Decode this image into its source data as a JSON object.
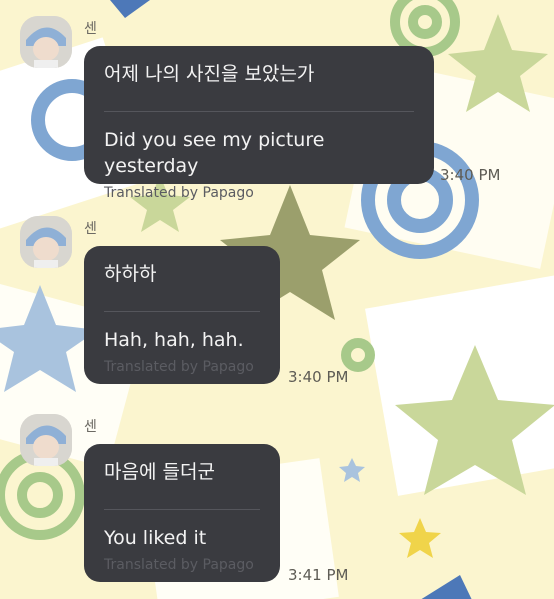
{
  "messages": [
    {
      "sender": "센",
      "original": "어제 나의 사진을 보았는가",
      "translation": "Did you see my picture yesterday",
      "credit": "Translated by Papago",
      "time": "3:40 PM"
    },
    {
      "sender": "센",
      "original": "하하하",
      "translation": "Hah, hah, hah.",
      "credit": "Translated by Papago",
      "time": "3:40 PM"
    },
    {
      "sender": "센",
      "original": "마음에 들더군",
      "translation": "You liked it",
      "credit": "Translated by Papago",
      "time": "3:41 PM"
    }
  ],
  "theme": {
    "background": "#fbf5cf",
    "bubble": "#3a3b40",
    "star_green": "#c9d79a",
    "star_blue": "#a9c3de",
    "spiral_blue": "#7fa6d2",
    "spiral_green": "#a7c98a"
  }
}
